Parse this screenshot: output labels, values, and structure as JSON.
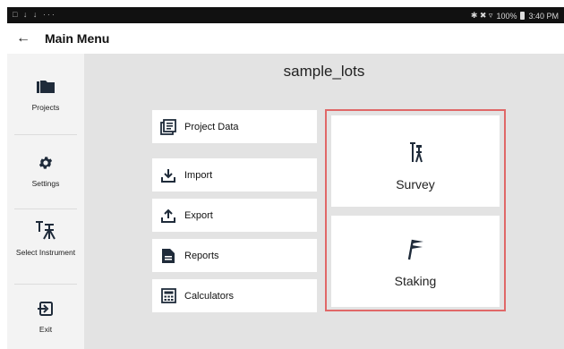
{
  "status_bar": {
    "left_icons": "□ ↓ ↓ ···",
    "right_icons": "✱ ✖ ▿",
    "battery": "100%",
    "time": "3:40 PM"
  },
  "app_bar": {
    "back_icon": "←",
    "title": "Main Menu"
  },
  "sidebar": {
    "items": [
      {
        "label": "Projects",
        "icon": "folder-icon"
      },
      {
        "label": "Settings",
        "icon": "gear-icon"
      },
      {
        "label": "Select Instrument",
        "icon": "instrument-icon"
      },
      {
        "label": "Exit",
        "icon": "exit-icon"
      }
    ]
  },
  "main": {
    "project_name": "sample_lots",
    "menu": [
      {
        "label": "Project Data",
        "icon": "project-data-icon"
      },
      {
        "label": "Import",
        "icon": "import-icon"
      },
      {
        "label": "Export",
        "icon": "export-icon"
      },
      {
        "label": "Reports",
        "icon": "reports-icon"
      },
      {
        "label": "Calculators",
        "icon": "calculator-icon"
      }
    ],
    "survey_label": "Survey",
    "staking_label": "Staking"
  },
  "colors": {
    "highlight_border": "#e06868",
    "main_bg": "#e3e3e3",
    "sidebar_bg": "#f3f3f3",
    "icon_dark": "#1f2b3a"
  }
}
